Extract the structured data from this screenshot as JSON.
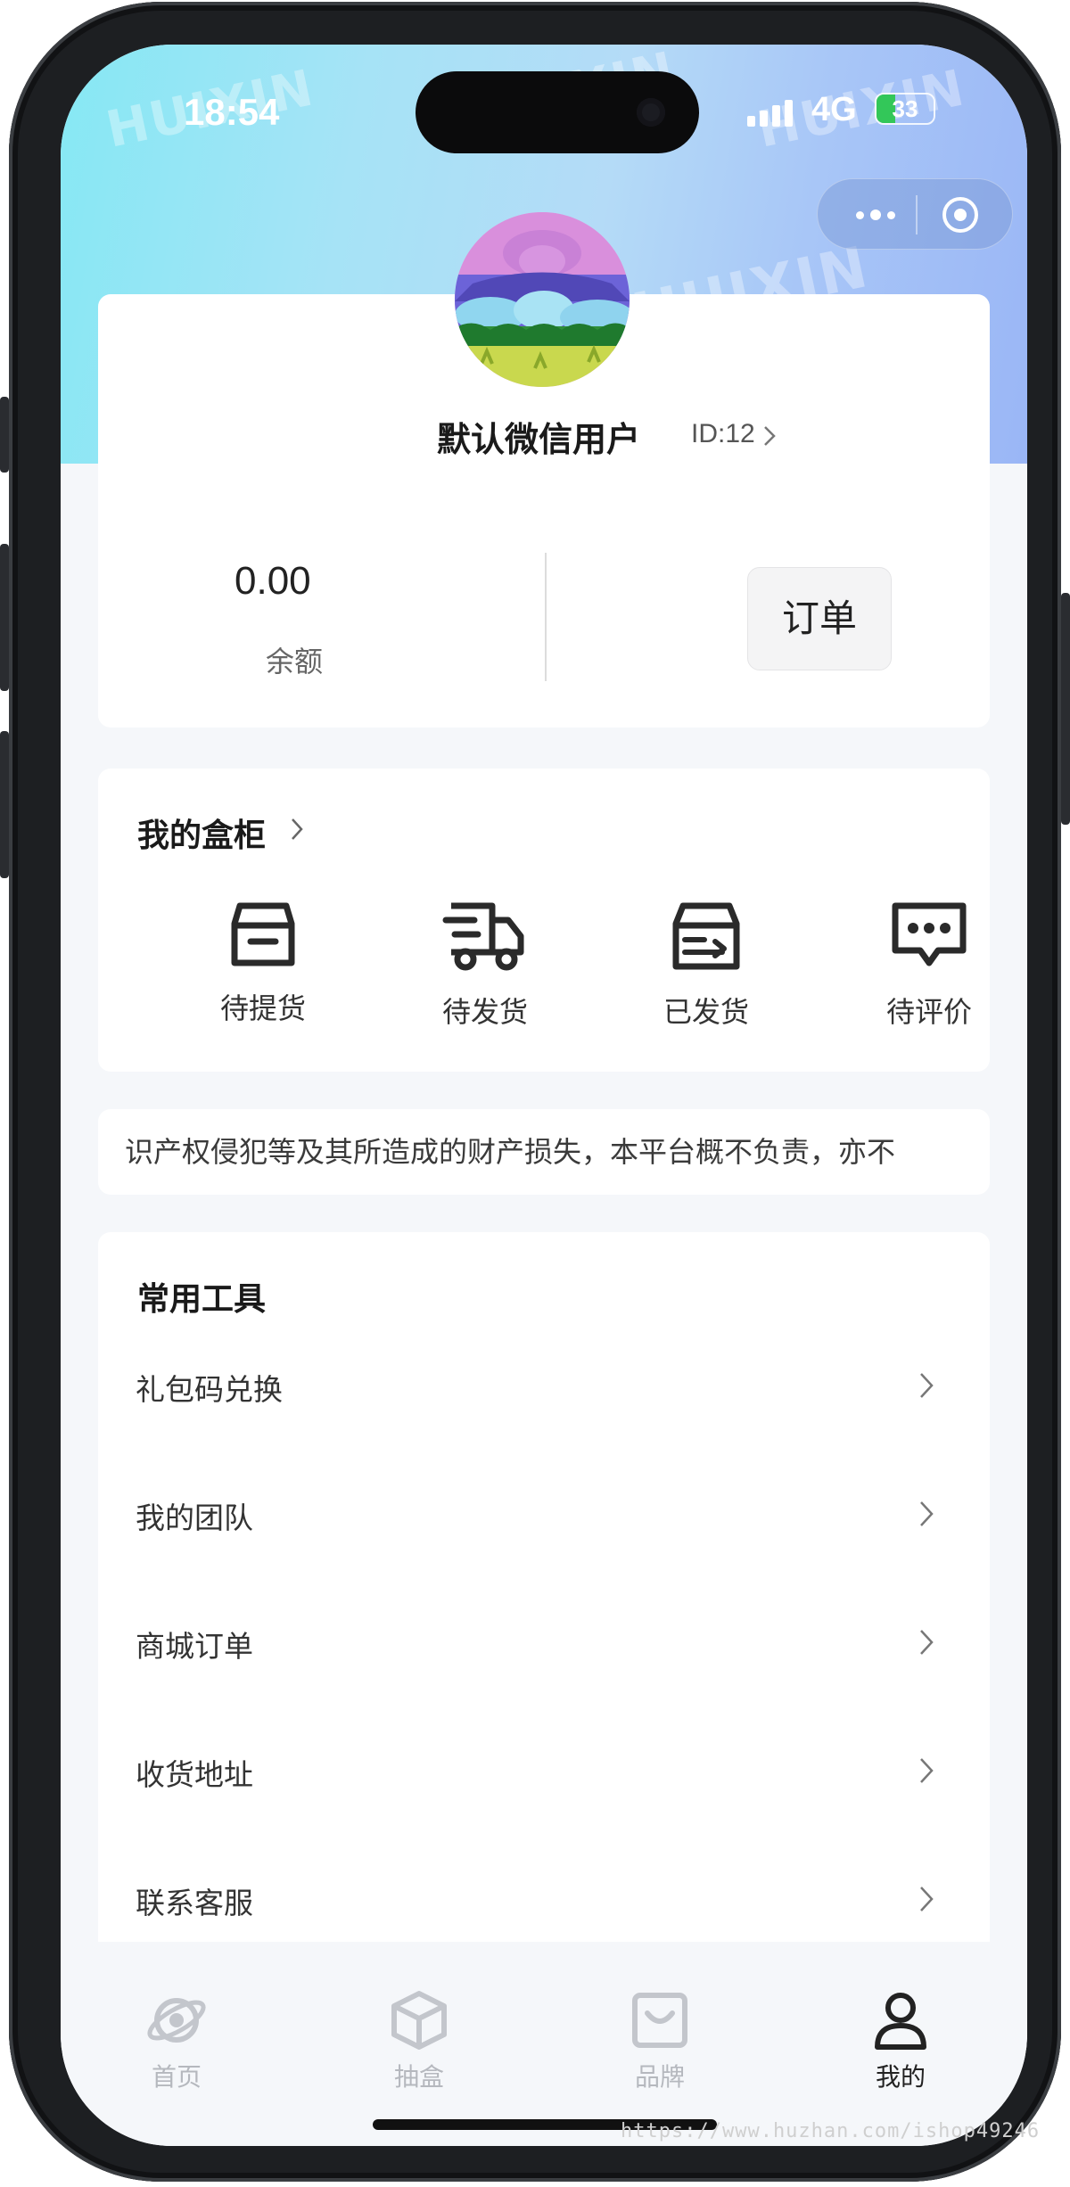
{
  "status_bar": {
    "time": "18:54",
    "network": "4G",
    "battery": "33",
    "battery_level": 0.33
  },
  "watermark": {
    "brand": "HUIXIN",
    "url": "https://www.huzhan.com/ishop49246"
  },
  "profile": {
    "username": "默认微信用户",
    "user_id": "ID:12",
    "balance_value": "0.00",
    "balance_label": "余额",
    "order_button": "订单"
  },
  "my_box": {
    "title": "我的盒柜",
    "statuses": [
      {
        "label": "待提货",
        "icon": "box-icon"
      },
      {
        "label": "待发货",
        "icon": "truck-icon"
      },
      {
        "label": "已发货",
        "icon": "shipped-box-icon"
      },
      {
        "label": "待评价",
        "icon": "comment-icon"
      }
    ]
  },
  "notice": {
    "text": "识产权侵犯等及其所造成的财产损失，本平台概不负责，亦不"
  },
  "tools": {
    "title": "常用工具",
    "items": [
      {
        "label": "礼包码兑换"
      },
      {
        "label": "我的团队"
      },
      {
        "label": "商城订单"
      },
      {
        "label": "收货地址"
      },
      {
        "label": "联系客服"
      }
    ]
  },
  "tabbar": {
    "items": [
      {
        "label": "首页",
        "icon": "planet-icon",
        "active": false
      },
      {
        "label": "抽盒",
        "icon": "cube-icon",
        "active": false
      },
      {
        "label": "品牌",
        "icon": "bag-icon",
        "active": false
      },
      {
        "label": "我的",
        "icon": "user-icon",
        "active": true
      }
    ]
  },
  "colors": {
    "active_tab": "#222222",
    "inactive_tab": "#b5b8be",
    "battery_green": "#33c759"
  }
}
